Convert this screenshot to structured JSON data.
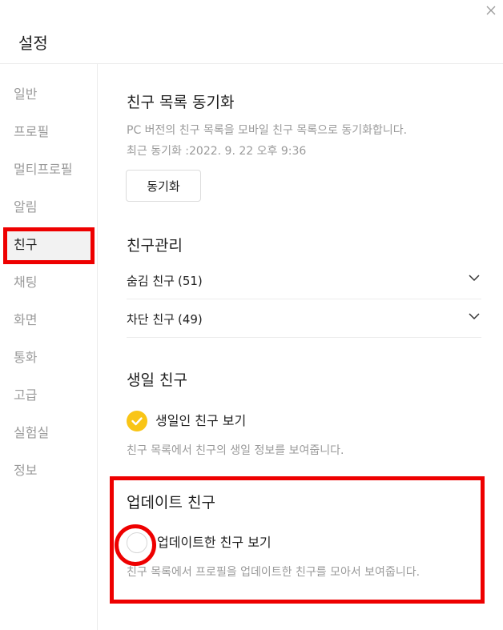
{
  "window": {
    "title": "설정",
    "close_icon": "close-icon"
  },
  "sidebar": {
    "items": [
      {
        "label": "일반"
      },
      {
        "label": "프로필"
      },
      {
        "label": "멀티프로필"
      },
      {
        "label": "알림"
      },
      {
        "label": "친구",
        "active": true
      },
      {
        "label": "채팅"
      },
      {
        "label": "화면"
      },
      {
        "label": "통화"
      },
      {
        "label": "고급"
      },
      {
        "label": "실험실"
      },
      {
        "label": "정보"
      }
    ]
  },
  "sync": {
    "title": "친구 목록 동기화",
    "description": "PC 버전의 친구 목록을 모바일 친구 목록으로 동기화합니다.",
    "last_sync": "최근 동기화 :2022. 9. 22 오후 9:36",
    "button_label": "동기화"
  },
  "manage": {
    "title": "친구관리",
    "rows": [
      {
        "label": "숨김 친구",
        "count": "(51)",
        "icon": "chevron-down-icon"
      },
      {
        "label": "차단 친구",
        "count": "(49)",
        "icon": "chevron-down-icon"
      }
    ]
  },
  "birthday": {
    "title": "생일 친구",
    "checkbox_label": "생일인 친구 보기",
    "checked": true,
    "description": "친구 목록에서 친구의 생일 정보를 보여줍니다."
  },
  "update": {
    "title": "업데이트 친구",
    "checkbox_label": "업데이트한 친구 보기",
    "checked": false,
    "description": "친구 목록에서 프로필을 업데이트한 친구를 모아서 보여줍니다."
  },
  "colors": {
    "accent": "#f9c516",
    "highlight": "#ee0000",
    "muted_text": "#9a9a9a"
  }
}
